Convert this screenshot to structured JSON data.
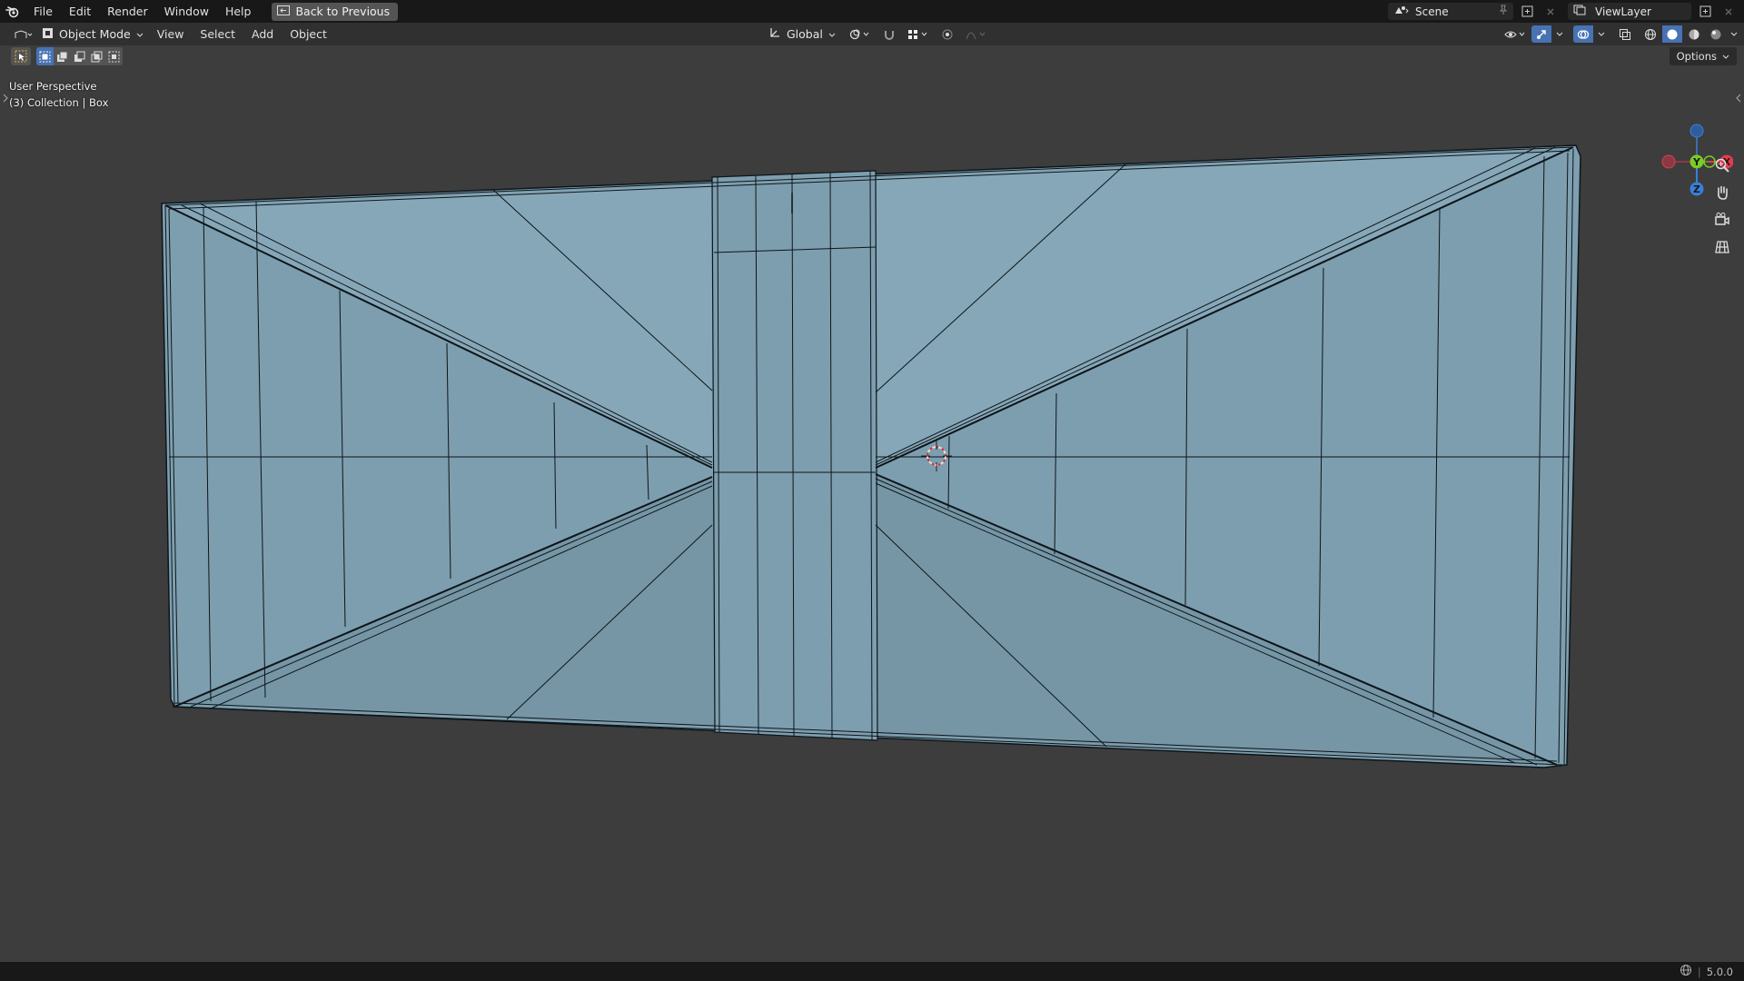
{
  "topbar": {
    "menus": [
      "File",
      "Edit",
      "Render",
      "Window",
      "Help"
    ],
    "back_label": "Back to Previous",
    "scene_name": "Scene",
    "view_layer": "ViewLayer"
  },
  "header": {
    "mode": "Object Mode",
    "menus": [
      "View",
      "Select",
      "Add",
      "Object"
    ],
    "transform_orientation": "Global"
  },
  "toolbar": {
    "options_label": "Options"
  },
  "viewport": {
    "perspective_label": "User Perspective",
    "collection_label": "(3) Collection | Box"
  },
  "gizmo": {
    "x": "X",
    "y": "Y",
    "z": "Z",
    "colors": {
      "x": "#e8394e",
      "y": "#7bcc25",
      "z": "#3b7fd9"
    }
  },
  "statusbar": {
    "version": "5.0.0"
  },
  "colors": {
    "mesh_fill": "#7e9fb0",
    "mesh_wire": "#0d1519",
    "viewport_bg": "#3d3d3d",
    "accent": "#4772b3"
  }
}
